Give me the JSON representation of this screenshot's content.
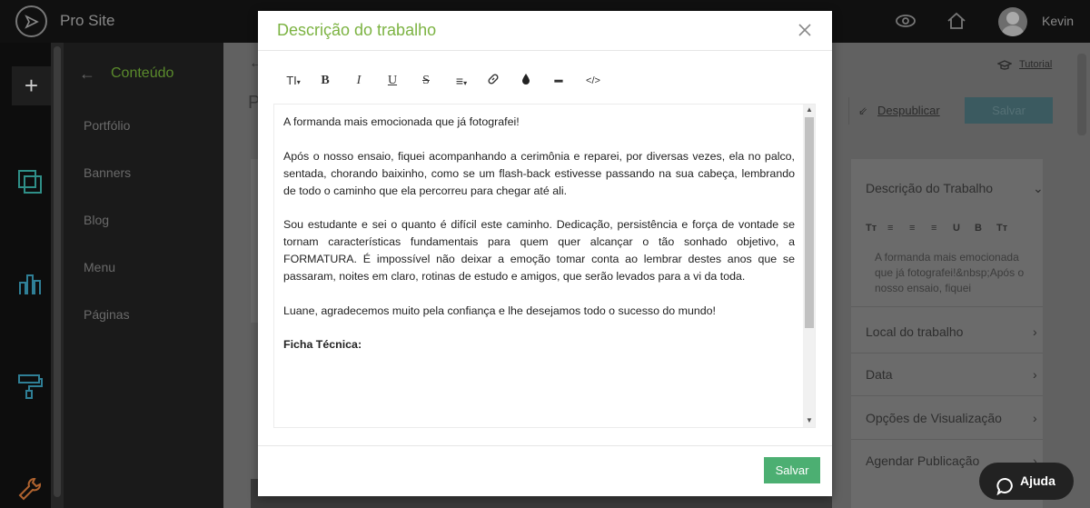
{
  "topbar": {
    "site_name": "Pro Site",
    "username": "Kevin",
    "icons": [
      "eye-icon",
      "home-icon",
      "avatar"
    ]
  },
  "rail": {
    "add_label": "+",
    "icons": [
      "pages-icon",
      "chart-icon",
      "paint-roller-icon",
      "wrench-icon"
    ]
  },
  "content_menu": {
    "title": "Conteúdo",
    "items": [
      "Portfólio",
      "Banners",
      "Blog",
      "Menu",
      "Páginas"
    ]
  },
  "background_page": {
    "title_initial": "P",
    "tutorial_label": "Tutorial",
    "unpublish_label": "Despublicar",
    "save_label": "Salvar",
    "right_panel": {
      "section_title": "Descrição do Trabalho",
      "toolbar": [
        "Tт",
        "≡",
        "≡",
        "≡",
        "U",
        "B",
        "Tт"
      ],
      "preview_text": "A formanda mais emocionada que já fotografei!&nbsp;Após o nosso ensaio, fiquei",
      "items": [
        "Local do trabalho",
        "Data",
        "Opções de Visualização",
        "Agendar Publicação"
      ]
    }
  },
  "modal": {
    "title": "Descrição do trabalho",
    "toolbar": [
      "TI",
      "B",
      "I",
      "U",
      "S",
      "≡",
      "link-icon",
      "drop-icon",
      "━",
      "</>"
    ],
    "paragraphs": [
      "A formanda mais emocionada que já fotografei!",
      "Após o nosso ensaio, fiquei acompanhando a cerimônia e reparei, por diversas vezes, ela no palco, sentada, chorando baixinho, como se um flash-back estivesse passando na sua cabeça, lembrando de todo o caminho que ela percorreu para chegar até ali.",
      "Sou estudante e sei o quanto é difícil este caminho. Dedicação, persistência e força de vontade se tornam características fundamentais para quem quer alcançar o tão sonhado objetivo, a FORMATURA. É impossível não deixar a emoção tomar conta ao lembrar destes anos que se passaram, noites em claro, rotinas de estudo e amigos, que serão levados para a vi da toda.",
      "Luane, agradecemos muito pela confiança e lhe desejamos todo o sucesso do mundo!",
      "Ficha Técnica:"
    ],
    "save_label": "Salvar"
  },
  "help": {
    "label": "Ajuda"
  },
  "colors": {
    "accent_green": "#7cb342",
    "save_green": "#4caf72"
  }
}
